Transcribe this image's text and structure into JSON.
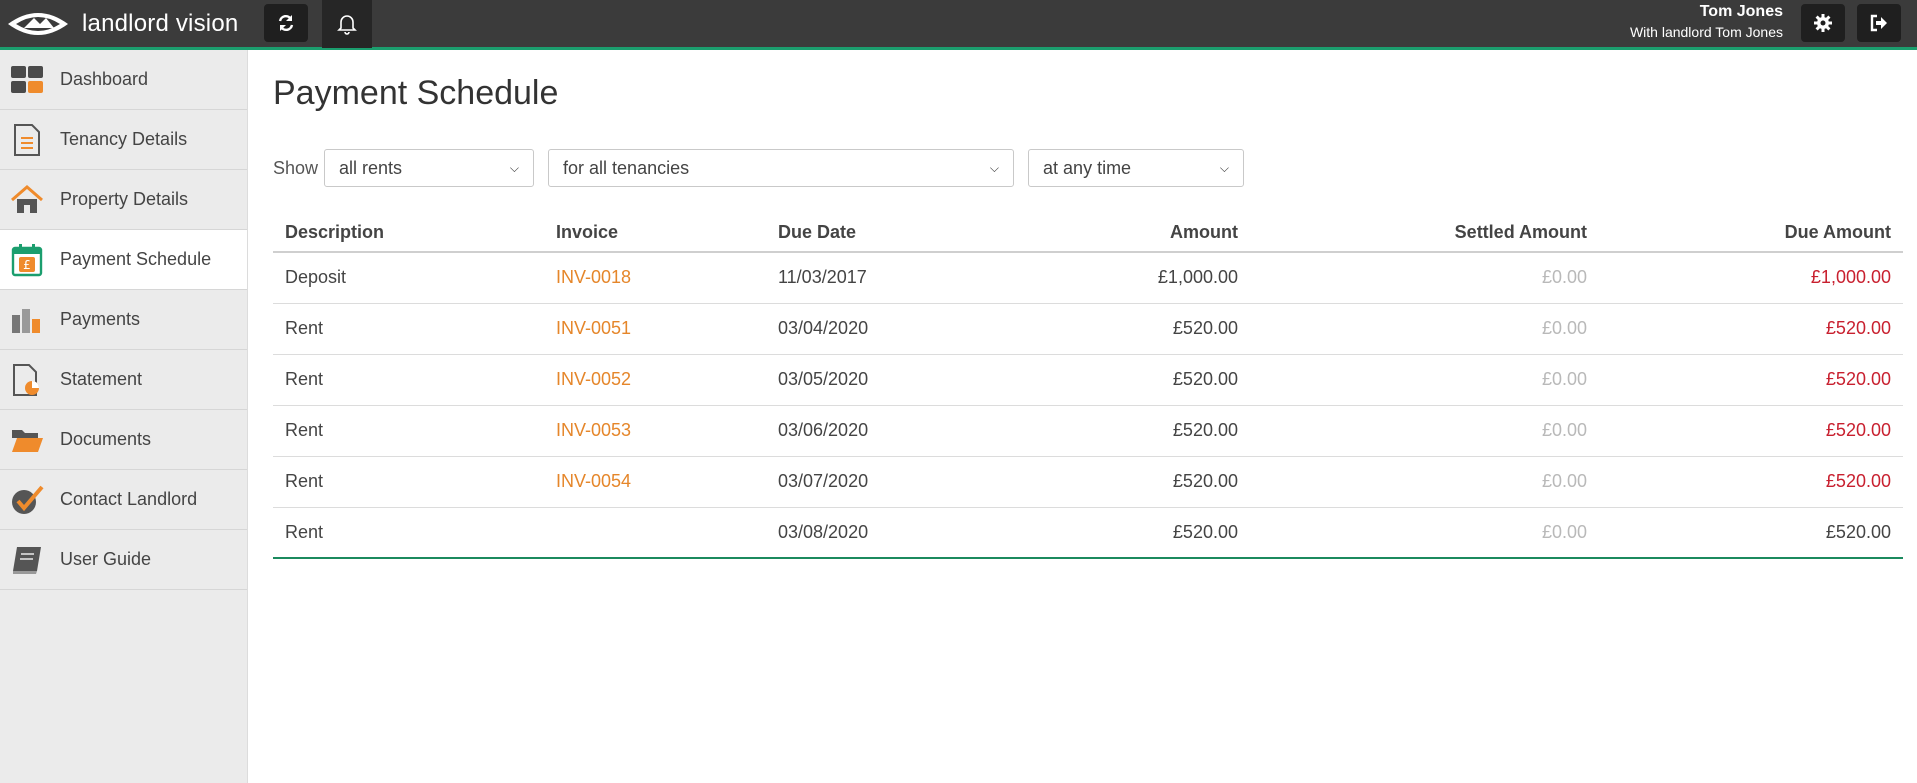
{
  "app": {
    "brand": "landlord vision",
    "user_name": "Tom Jones",
    "user_sub": "With landlord Tom Jones"
  },
  "icons": {
    "refresh": "refresh-icon",
    "bell": "bell-icon",
    "gear": "gear-icon",
    "signout": "sign-out-icon"
  },
  "colors": {
    "topbar": "#3b3b3b",
    "accent": "#1b9e6e",
    "invoice_link": "#e5862a",
    "due_red": "#c8202f"
  },
  "sidebar": {
    "items": [
      {
        "label": "Dashboard",
        "icon": "dashboard-icon",
        "active": false
      },
      {
        "label": "Tenancy Details",
        "icon": "document-icon",
        "active": false
      },
      {
        "label": "Property Details",
        "icon": "house-icon",
        "active": false
      },
      {
        "label": "Payment Schedule",
        "icon": "calendar-pound-icon",
        "active": true
      },
      {
        "label": "Payments",
        "icon": "coins-icon",
        "active": false
      },
      {
        "label": "Statement",
        "icon": "statement-icon",
        "active": false
      },
      {
        "label": "Documents",
        "icon": "folder-icon",
        "active": false
      },
      {
        "label": "Contact Landlord",
        "icon": "checkmark-icon",
        "active": false
      },
      {
        "label": "User Guide",
        "icon": "book-icon",
        "active": false
      }
    ]
  },
  "main": {
    "title": "Payment Schedule",
    "filters": {
      "show_label": "Show",
      "rent_type": "all rents",
      "tenancy": "for all tenancies",
      "period": "at any time"
    },
    "table": {
      "headers": [
        "Description",
        "Invoice",
        "Due Date",
        "Amount",
        "Settled Amount",
        "Due Amount"
      ],
      "rows": [
        {
          "description": "Deposit",
          "invoice": "INV-0018",
          "due_date": "11/03/2017",
          "amount": "£1,000.00",
          "settled": "£0.00",
          "due": "£1,000.00"
        },
        {
          "description": "Rent",
          "invoice": "INV-0051",
          "due_date": "03/04/2020",
          "amount": "£520.00",
          "settled": "£0.00",
          "due": "£520.00"
        },
        {
          "description": "Rent",
          "invoice": "INV-0052",
          "due_date": "03/05/2020",
          "amount": "£520.00",
          "settled": "£0.00",
          "due": "£520.00"
        },
        {
          "description": "Rent",
          "invoice": "INV-0053",
          "due_date": "03/06/2020",
          "amount": "£520.00",
          "settled": "£0.00",
          "due": "£520.00"
        },
        {
          "description": "Rent",
          "invoice": "INV-0054",
          "due_date": "03/07/2020",
          "amount": "£520.00",
          "settled": "£0.00",
          "due": "£520.00"
        },
        {
          "description": "Rent",
          "invoice": "",
          "due_date": "03/08/2020",
          "amount": "£520.00",
          "settled": "£0.00",
          "due": "£520.00"
        }
      ]
    }
  }
}
